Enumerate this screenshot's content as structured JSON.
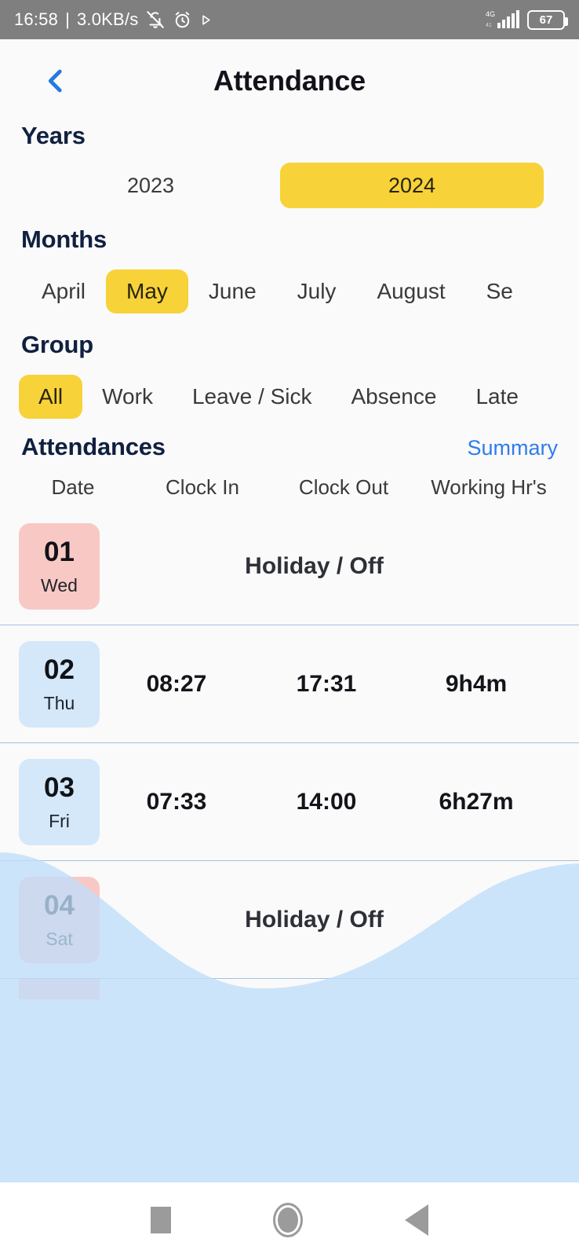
{
  "status_bar": {
    "clock": "16:58",
    "separator": "|",
    "net_speed": "3.0KB/s",
    "icons": [
      "mute-bell-icon",
      "alarm-clock-icon",
      "play-icon"
    ],
    "network_type": "4G",
    "battery_percent": "67"
  },
  "header": {
    "back_icon": "chevron-left-icon",
    "title": "Attendance"
  },
  "years": {
    "label": "Years",
    "items": [
      {
        "label": "2023",
        "selected": false
      },
      {
        "label": "2024",
        "selected": true
      }
    ]
  },
  "months": {
    "label": "Months",
    "items": [
      {
        "label": "April",
        "selected": false
      },
      {
        "label": "May",
        "selected": true
      },
      {
        "label": "June",
        "selected": false
      },
      {
        "label": "July",
        "selected": false
      },
      {
        "label": "August",
        "selected": false
      },
      {
        "label": "Se",
        "selected": false
      }
    ]
  },
  "group": {
    "label": "Group",
    "items": [
      {
        "label": "All",
        "selected": true
      },
      {
        "label": "Work",
        "selected": false
      },
      {
        "label": "Leave / Sick",
        "selected": false
      },
      {
        "label": "Absence",
        "selected": false
      },
      {
        "label": "Late",
        "selected": false
      }
    ]
  },
  "attendances": {
    "title": "Attendances",
    "summary_link": "Summary",
    "columns": [
      "Date",
      "Clock In",
      "Clock Out",
      "Working Hr's"
    ],
    "rows": [
      {
        "day": "01",
        "dow": "Wed",
        "badge": "pink",
        "type": "off",
        "status": "Holiday / Off",
        "clock_in": "",
        "clock_out": "",
        "working": ""
      },
      {
        "day": "02",
        "dow": "Thu",
        "badge": "blue",
        "type": "work",
        "status": "",
        "clock_in": "08:27",
        "clock_out": "17:31",
        "working": "9h4m"
      },
      {
        "day": "03",
        "dow": "Fri",
        "badge": "blue",
        "type": "work",
        "status": "",
        "clock_in": "07:33",
        "clock_out": "14:00",
        "working": "6h27m"
      },
      {
        "day": "04",
        "dow": "Sat",
        "badge": "pink",
        "type": "off",
        "status": "Holiday / Off",
        "clock_in": "",
        "clock_out": "",
        "working": ""
      }
    ]
  },
  "nav_bar": {
    "items": [
      "recents-square-icon",
      "home-circle-icon",
      "back-triangle-icon"
    ]
  },
  "colors": {
    "accent_yellow": "#f7d239",
    "link_blue": "#2f7ced",
    "heading_navy": "#10203f",
    "badge_pink": "#f8c9c4",
    "badge_blue": "#d4e8fa",
    "wave_overlay": "#bfdefa",
    "status_bar_bg": "#7f7f7f",
    "page_bg": "#fafafa",
    "divider": "#9fc4e0"
  }
}
